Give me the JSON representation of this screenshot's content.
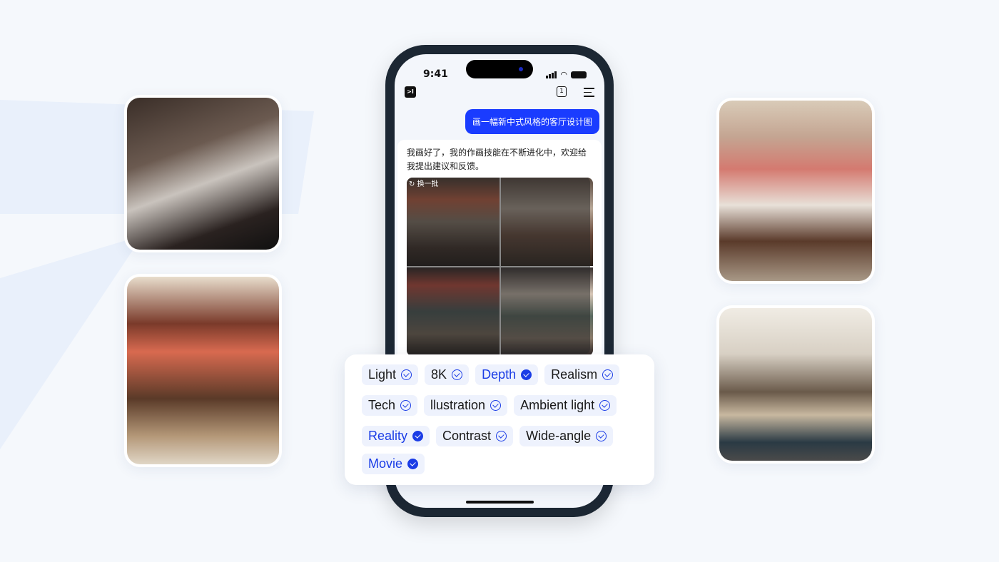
{
  "colors": {
    "accent": "#1a3cff",
    "background": "#f5f8fc",
    "tag_bg": "#eef2fd"
  },
  "status_bar": {
    "time": "9:41"
  },
  "header": {
    "logo": ">I",
    "count": "1",
    "menu_icon": "hamburger-icon"
  },
  "chat": {
    "user_message": "画一幅新中式风格的客厅设计图",
    "bot_message": "我画好了，我的作画技能在不断进化中，欢迎给我提出建议和反馈。",
    "refresh_label": "换一批"
  },
  "tags": [
    [
      {
        "label": "Light",
        "selected": false
      },
      {
        "label": "8K",
        "selected": false
      },
      {
        "label": "Depth",
        "selected": true
      },
      {
        "label": "Realism",
        "selected": false
      }
    ],
    [
      {
        "label": "Tech",
        "selected": false
      },
      {
        "label": "llustration",
        "selected": false
      },
      {
        "label": "Ambient light",
        "selected": false
      }
    ],
    [
      {
        "label": "Reality",
        "selected": true
      },
      {
        "label": "Contrast",
        "selected": false
      },
      {
        "label": "Wide-angle",
        "selected": false
      }
    ],
    [
      {
        "label": "Movie",
        "selected": true
      }
    ]
  ]
}
